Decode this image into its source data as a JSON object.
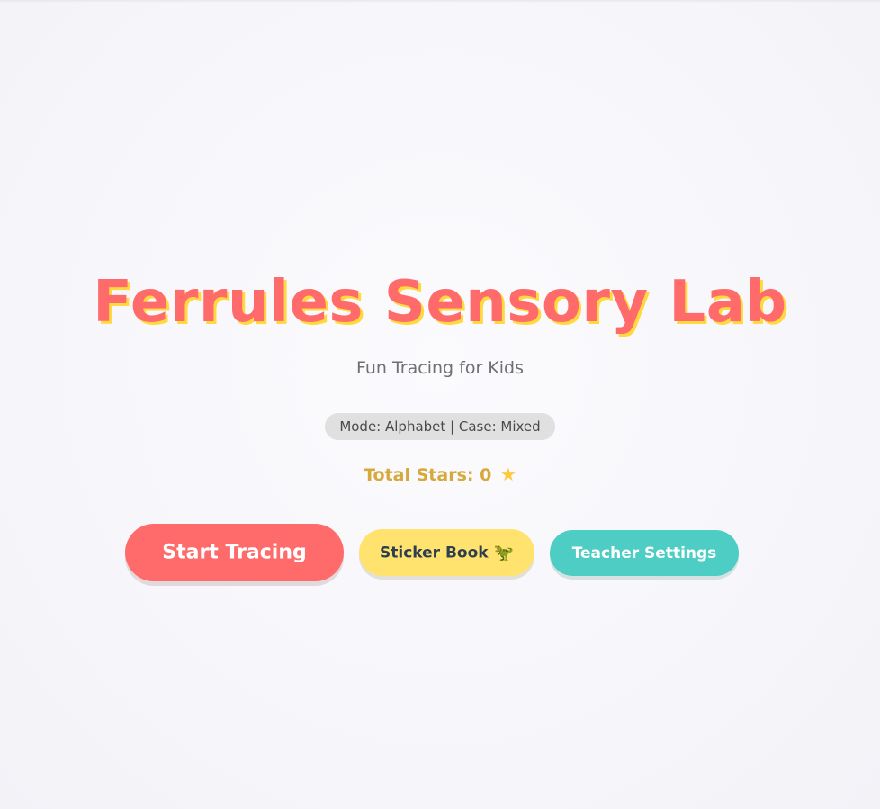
{
  "app": {
    "title": "Ferrules Sensory Lab",
    "subtitle": "Fun Tracing for Kids"
  },
  "status": {
    "mode_text": "Mode: Alphabet | Case: Mixed",
    "stars_text": "Total Stars: 0",
    "star_icon": "star-icon"
  },
  "actions": {
    "start_label": "Start Tracing",
    "sticker_label": "Sticker Book",
    "sticker_icon": "dinosaur-icon",
    "teacher_label": "Teacher Settings"
  },
  "colors": {
    "primary": "#ff6b6b",
    "accent_yellow": "#ffe36e",
    "accent_teal": "#4ecdc4",
    "title_shadow": "#ffd93d",
    "stars_text": "#d6a93a"
  }
}
